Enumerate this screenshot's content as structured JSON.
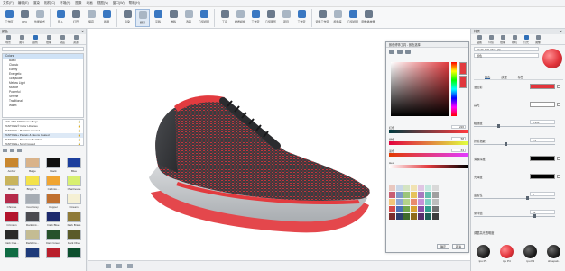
{
  "menu": [
    "文件(F)",
    "编辑(E)",
    "渲染",
    "相机(C)",
    "环境(N)",
    "图像",
    "动画",
    "视图(V)",
    "窗口(W)",
    "帮助(H)"
  ],
  "toolbar": {
    "items": [
      {
        "label": "工作区",
        "active": false
      },
      {
        "label": "CPU",
        "active": false
      },
      {
        "label": "性能模式",
        "active": false
      },
      {
        "label": "导入",
        "active": false
      },
      {
        "label": "打开",
        "active": false
      },
      {
        "label": "保存",
        "active": false
      },
      {
        "label": "截屏",
        "active": false
      },
      {
        "label": "渲染",
        "active": false
      },
      {
        "label": "翻滚",
        "active": true
      },
      {
        "label": "平移",
        "active": false
      },
      {
        "label": "推移",
        "active": false
      },
      {
        "label": "选取",
        "active": false
      },
      {
        "label": "几何视图",
        "active": false
      },
      {
        "label": "工具",
        "active": false
      },
      {
        "label": "材质模板",
        "active": false
      },
      {
        "label": "工作室",
        "active": false
      },
      {
        "label": "几何图形",
        "active": false
      },
      {
        "label": "项目",
        "active": false
      },
      {
        "label": "工作室",
        "active": false
      },
      {
        "label": "调色工作室",
        "active": false
      },
      {
        "label": "颜色库",
        "active": false
      },
      {
        "label": "几何视图",
        "active": false
      },
      {
        "label": "图像播放器",
        "active": false
      }
    ]
  },
  "left_panel": {
    "title": "颜色",
    "tabs": [
      "场景",
      "图书",
      "颜色",
      "纹理",
      "动画",
      "资源"
    ],
    "search_placeholder": "",
    "palettes": [
      {
        "name": "Colors",
        "selected": true
      },
      {
        "name": "Basic",
        "selected": false
      },
      {
        "name": "Classic",
        "selected": false
      },
      {
        "name": "Earthy",
        "selected": false
      },
      {
        "name": "Energetic",
        "selected": false
      },
      {
        "name": "Grayscale",
        "selected": false
      },
      {
        "name": "Mellow Light",
        "selected": false
      },
      {
        "name": "Muscle",
        "selected": false
      },
      {
        "name": "Powerful",
        "selected": false
      },
      {
        "name": "Serene",
        "selected": false
      },
      {
        "name": "Traditional",
        "selected": false
      },
      {
        "name": "Warm",
        "selected": false
      }
    ],
    "libraries": [
      {
        "name": "FGE-2TO-SDS Camouflage",
        "selected": false
      },
      {
        "name": "PANTONE® Color Libraries",
        "selected": false
      },
      {
        "name": "PANTONE+ Metallics Coated",
        "selected": false
      },
      {
        "name": "PANTONE+ Pastels & Neons Coated",
        "selected": true
      },
      {
        "name": "PANTONE+ Premium Metallics",
        "selected": false
      },
      {
        "name": "PANTONE+ Solid Coated",
        "selected": false
      }
    ],
    "swatches": [
      {
        "name": "Amber",
        "color": "#c8862e"
      },
      {
        "name": "Beige",
        "color": "#d9b38a"
      },
      {
        "name": "Black",
        "color": "#111111"
      },
      {
        "name": "Blue",
        "color": "#1c3e9c"
      },
      {
        "name": "Brass",
        "color": "#c9b45c"
      },
      {
        "name": "Bright Y...",
        "color": "#f3e24a"
      },
      {
        "name": "Cadmiu...",
        "color": "#f0a531"
      },
      {
        "name": "Chartreuse",
        "color": "#d8f070"
      },
      {
        "name": "Chrome",
        "color": "#b52b4a"
      },
      {
        "name": "Cool Grey",
        "color": "#a6acb3"
      },
      {
        "name": "Copper",
        "color": "#c0702f"
      },
      {
        "name": "Cream",
        "color": "#f5f0d4"
      },
      {
        "name": "Crimson",
        "color": "#b3142c"
      },
      {
        "name": "Dark Ant...",
        "color": "#4a4a4f"
      },
      {
        "name": "Dark Blue",
        "color": "#1d2a6d"
      },
      {
        "name": "Dark Brass",
        "color": "#8f7a37"
      },
      {
        "name": "Dark Cha...",
        "color": "#2a2a2a"
      },
      {
        "name": "Dark Cre...",
        "color": "#c4bc93"
      },
      {
        "name": "Dark Green",
        "color": "#27522c"
      },
      {
        "name": "Dark Olive",
        "color": "#5b5b2a"
      },
      {
        "name": "",
        "color": "#0f6b43"
      },
      {
        "name": "",
        "color": "#1d3a7a"
      },
      {
        "name": "",
        "color": "#b91f2c"
      },
      {
        "name": "",
        "color": "#0c4f2e"
      }
    ]
  },
  "color_editor": {
    "title": "颜色修饰工具 - 颜色选择",
    "channels": [
      {
        "label": "红色",
        "value": "226"
      },
      {
        "label": "绿色",
        "value": "58"
      },
      {
        "label": "蓝色",
        "value": "63"
      }
    ],
    "hex_label": "Hex",
    "ok_label": "确定",
    "cancel_label": "取消",
    "pattern_colors": [
      "#e9c8c0",
      "#c9d7e8",
      "#d4e4c3",
      "#f1e3b3",
      "#e0c6e4",
      "#c6e8e0",
      "#d9d9d9",
      "#c85e73",
      "#7e9ac9",
      "#9cc57b",
      "#e6c35b",
      "#a87ac0",
      "#64bfae",
      "#a0a0a0",
      "#f2c57a",
      "#8fa7d4",
      "#b4d38a",
      "#e98b6d",
      "#c791d8",
      "#7fd1c4",
      "#bdbdbd",
      "#d44b4b",
      "#4a6fb5",
      "#6fa64d",
      "#d9a233",
      "#8a4fa8",
      "#2f9e8e",
      "#6f6f6f",
      "#7a2d2d",
      "#2c3e6e",
      "#3f6b2c",
      "#8f6a1c",
      "#56306b",
      "#1d6157",
      "#3d3d3d"
    ]
  },
  "right_panel": {
    "title": "材质",
    "tabs": [
      "贴图",
      "环境",
      "纹理",
      "相机",
      "灯光",
      "图像"
    ],
    "material_name": "Ub 9b 9F5 UM-2 (9)",
    "type_label": "颜色",
    "subtabs": [
      "颜色",
      "纹理",
      "标签"
    ],
    "properties": [
      {
        "name": "漫反射",
        "kind": "swatch",
        "color": "#e2343b"
      },
      {
        "name": "高光",
        "kind": "swatch",
        "color": "#ffffff"
      },
      {
        "name": "粗糙度",
        "kind": "number",
        "value": "0.131"
      },
      {
        "name": "折射指数",
        "kind": "number",
        "value": "1.5"
      },
      {
        "name": "薄膜厚度",
        "kind": "swatch",
        "color": "#000000"
      },
      {
        "name": "光泽度",
        "kind": "swatch",
        "color": "#000000"
      },
      {
        "name": "金属性",
        "kind": "number",
        "value": "0"
      },
      {
        "name": "采样值",
        "kind": "number",
        "value": "24"
      }
    ],
    "checkbox_label": "调整高光透明度",
    "materials": [
      {
        "name": "tpu P5",
        "red": false
      },
      {
        "name": "tpu P4",
        "red": true
      },
      {
        "name": "tpu P3",
        "red": false
      },
      {
        "name": "shoepatt...",
        "red": false
      }
    ]
  }
}
